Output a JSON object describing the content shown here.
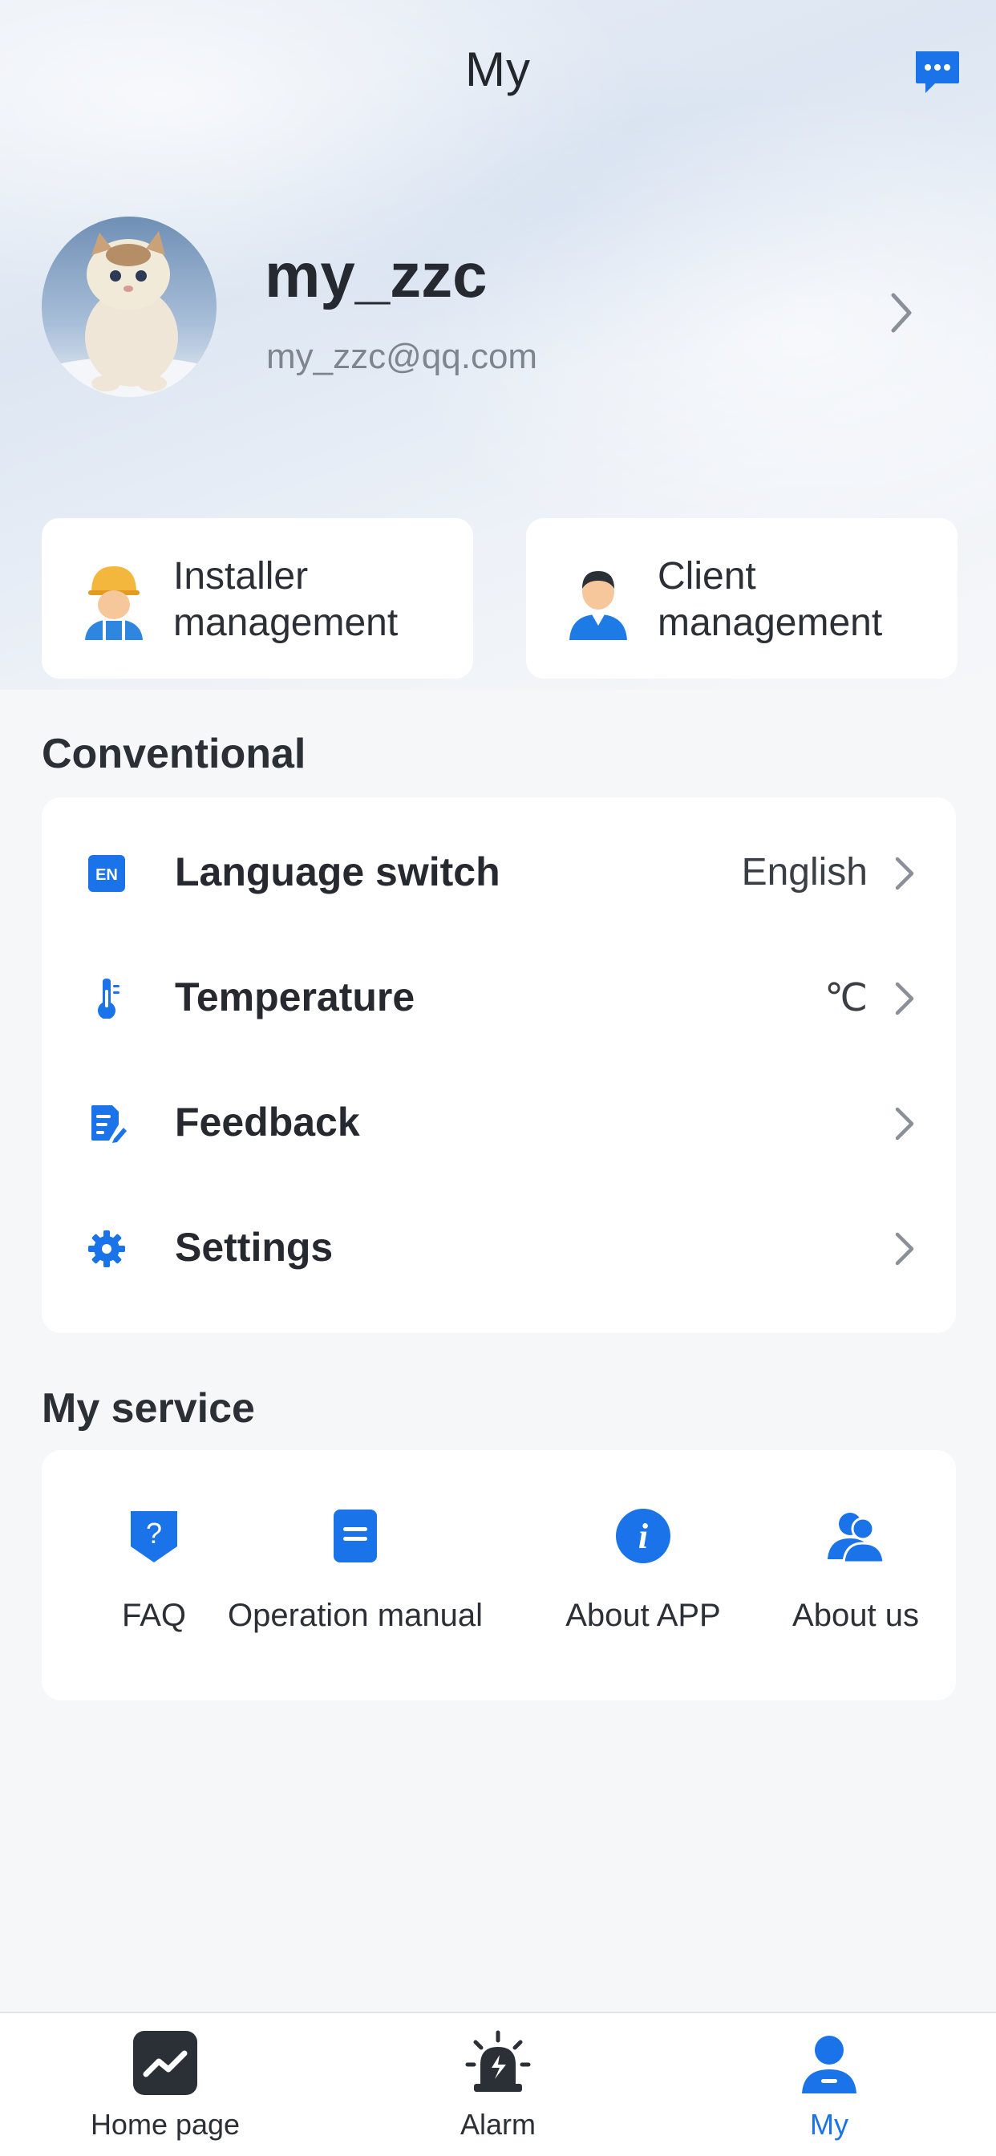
{
  "header": {
    "title": "My",
    "message_icon": "chat-bubble-icon"
  },
  "profile": {
    "username": "my_zzc",
    "email": "my_zzc@qq.com",
    "avatar": "cat-photo-avatar"
  },
  "management": [
    {
      "label": "Installer management",
      "icon": "installer-worker-icon"
    },
    {
      "label": "Client management",
      "icon": "client-person-icon"
    }
  ],
  "conventional": {
    "title": "Conventional",
    "items": [
      {
        "label": "Language switch",
        "value": "English",
        "icon": "en-language-icon"
      },
      {
        "label": "Temperature",
        "value": "℃",
        "icon": "thermometer-icon"
      },
      {
        "label": "Feedback",
        "value": "",
        "icon": "feedback-document-icon"
      },
      {
        "label": "Settings",
        "value": "",
        "icon": "gear-icon"
      }
    ]
  },
  "service": {
    "title": "My service",
    "items": [
      {
        "label": "FAQ",
        "icon": "question-shield-icon"
      },
      {
        "label": "Operation manual",
        "icon": "manual-book-icon"
      },
      {
        "label": "About APP",
        "icon": "info-circle-icon"
      },
      {
        "label": "About us",
        "icon": "people-icon"
      }
    ]
  },
  "tabbar": {
    "items": [
      {
        "label": "Home page",
        "icon": "chart-trend-icon"
      },
      {
        "label": "Alarm",
        "icon": "alarm-siren-icon"
      },
      {
        "label": "My",
        "icon": "user-icon"
      }
    ],
    "active": "My"
  },
  "colors": {
    "accent": "#1a73e8",
    "background": "#f6f7f9",
    "card": "#ffffff",
    "text": "#2b2f36",
    "muted": "#7f858e"
  }
}
